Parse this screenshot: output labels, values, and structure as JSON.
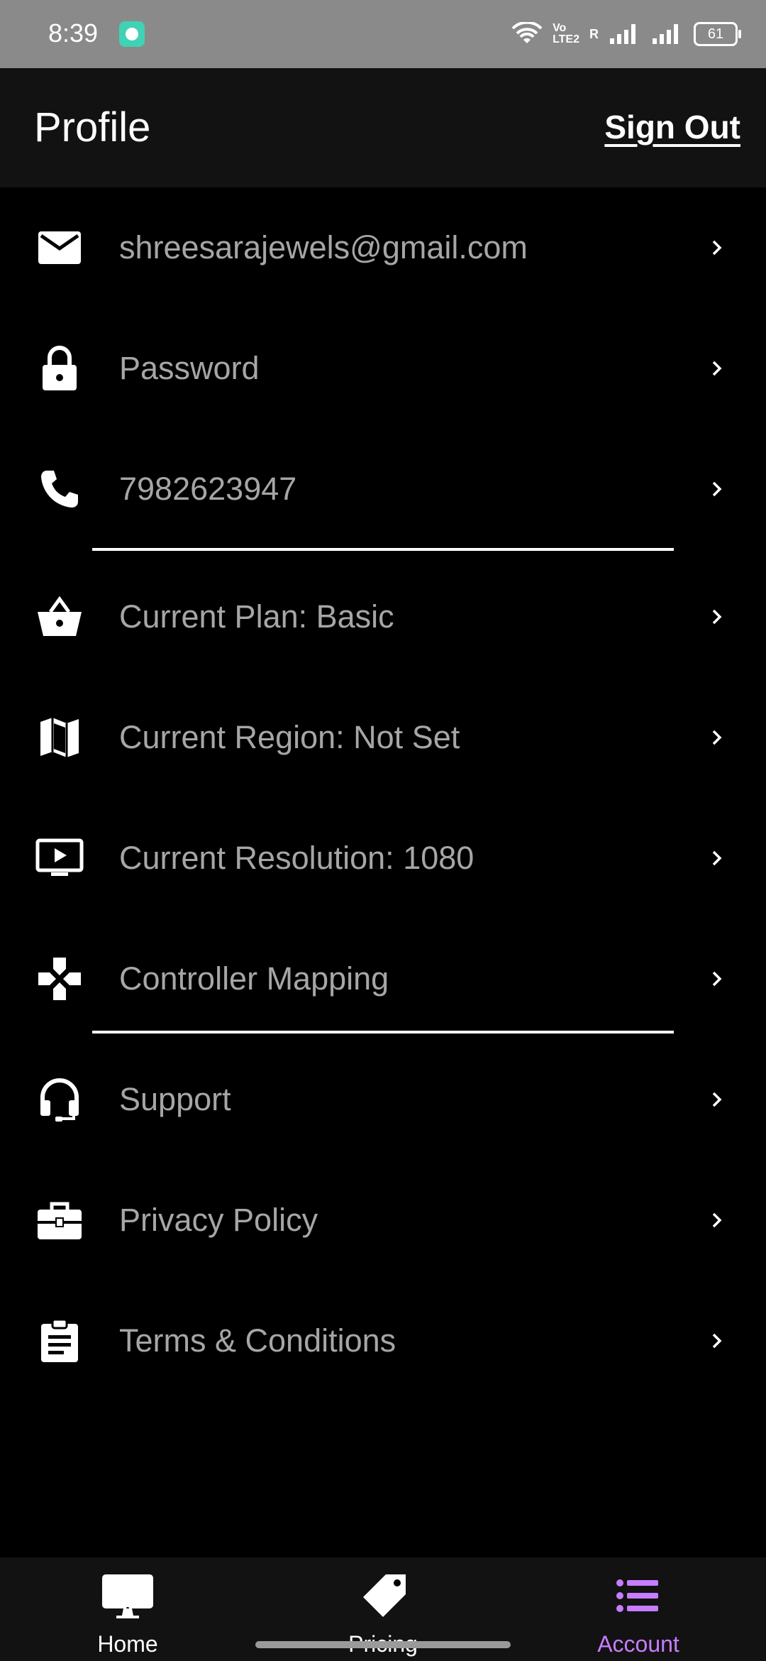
{
  "status_bar": {
    "time": "8:39",
    "volte_label": "Vo\nLTE2",
    "roaming_label": "R",
    "battery": "61"
  },
  "header": {
    "title": "Profile",
    "sign_out": "Sign Out"
  },
  "menu": {
    "email": "shreesarajewels@gmail.com",
    "password": "Password",
    "phone": "7982623947",
    "current_plan": "Current Plan: Basic",
    "current_region": "Current Region: Not Set",
    "current_resolution": "Current Resolution: 1080",
    "controller_mapping": "Controller Mapping",
    "support": "Support",
    "privacy_policy": "Privacy Policy",
    "terms": "Terms & Conditions"
  },
  "bottom_nav": {
    "home": "Home",
    "pricing": "Pricing",
    "account": "Account",
    "active": "Account",
    "active_color": "#c77dff"
  },
  "colors": {
    "background": "#000000",
    "appbar": "#121212",
    "label": "#a6a6a6"
  }
}
